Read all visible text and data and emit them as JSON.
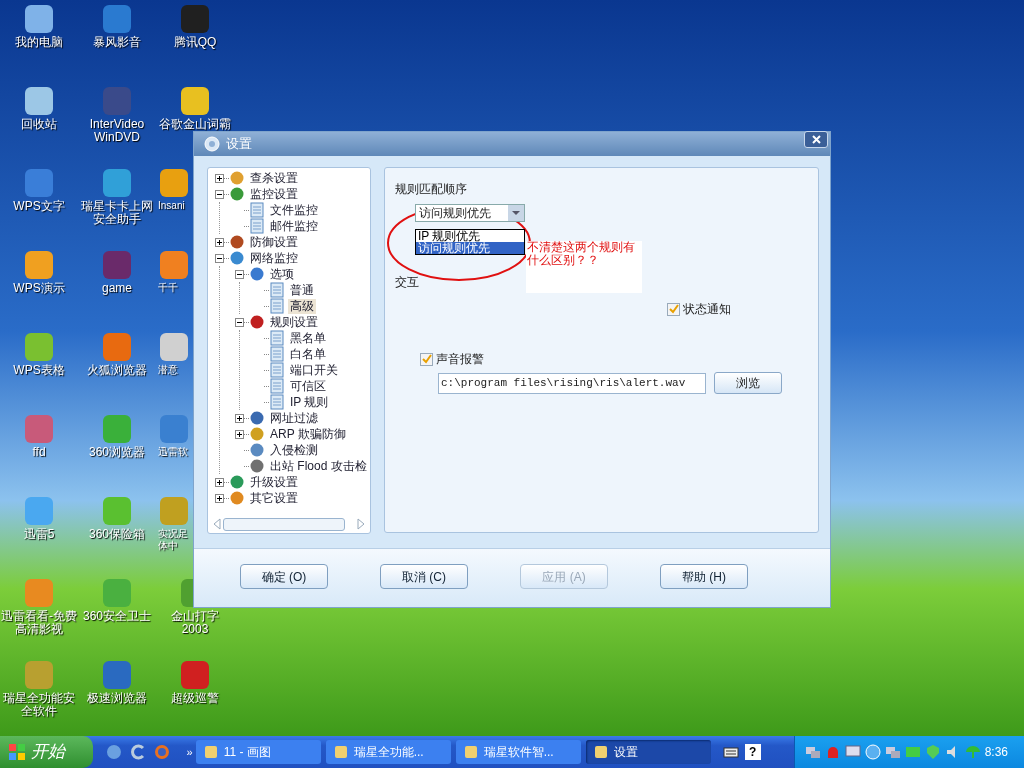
{
  "desktop_icons": [
    {
      "label": "我的电脑",
      "color": "#7fb2e8"
    },
    {
      "label": "回收站",
      "color": "#9cc7e6"
    },
    {
      "label": "WPS文字",
      "color": "#3a7ed8"
    },
    {
      "label": "WPS演示",
      "color": "#f0a020"
    },
    {
      "label": "WPS表格",
      "color": "#7ac030"
    },
    {
      "label": "ffd",
      "color": "#c85a7a"
    },
    {
      "label": "迅雷5",
      "color": "#4aa8f0"
    },
    {
      "label": "迅雷看看-免费高清影视",
      "color": "#e88a20"
    },
    {
      "label": "瑞星全功能安全软件",
      "color": "#b8a030"
    },
    {
      "label": "暴风影音",
      "color": "#2a7ad0"
    },
    {
      "label": "InterVideo WinDVD",
      "color": "#3a4a8a"
    },
    {
      "label": "瑞星卡卡上网安全助手",
      "color": "#30a0d8"
    },
    {
      "label": "game",
      "color": "#6a2a6a"
    },
    {
      "label": "火狐浏览器",
      "color": "#e86a10"
    },
    {
      "label": "360浏览器",
      "color": "#3ab03a"
    },
    {
      "label": "360保险箱",
      "color": "#5ac030"
    },
    {
      "label": "360安全卫士",
      "color": "#4ab040"
    },
    {
      "label": "极速浏览器",
      "color": "#2a6ac0"
    },
    {
      "label": "腾讯QQ",
      "color": "#202020"
    },
    {
      "label": "谷歌金山词霸",
      "color": "#e8c020"
    },
    {
      "label": "Insani",
      "color": "#e8a010"
    },
    {
      "label": "千千",
      "color": "#f08020"
    },
    {
      "label": "潜意",
      "color": "#d0d0d0"
    },
    {
      "label": "迅雷软",
      "color": "#3a80d0"
    },
    {
      "label": "实况足体中",
      "color": "#c0a020"
    },
    {
      "label": "金山打字 2003",
      "color": "#50a030"
    },
    {
      "label": "超级巡警",
      "color": "#d02020"
    }
  ],
  "dialog": {
    "title": "设置",
    "tree": [
      {
        "label": "查杀设置",
        "kind": "group",
        "color": "#e0a030",
        "expanded": false,
        "selected": false
      },
      {
        "label": "监控设置",
        "kind": "group",
        "color": "#3a9a3a",
        "expanded": true,
        "selected": false,
        "children": [
          {
            "label": "文件监控",
            "kind": "page",
            "selected": false
          },
          {
            "label": "邮件监控",
            "kind": "page",
            "selected": false
          }
        ]
      },
      {
        "label": "防御设置",
        "kind": "group",
        "color": "#b04a20",
        "expanded": false,
        "selected": false
      },
      {
        "label": "网络监控",
        "kind": "group",
        "color": "#3a8ad0",
        "expanded": true,
        "selected": false,
        "children": [
          {
            "label": "选项",
            "kind": "group",
            "color": "#3a7ad0",
            "expanded": true,
            "selected": false,
            "children": [
              {
                "label": "普通",
                "kind": "page",
                "selected": false
              },
              {
                "label": "高级",
                "kind": "page",
                "selected": true
              }
            ]
          },
          {
            "label": "规则设置",
            "kind": "group",
            "color": "#c02020",
            "expanded": true,
            "selected": false,
            "children": [
              {
                "label": "黑名单",
                "kind": "page",
                "selected": false
              },
              {
                "label": "白名单",
                "kind": "page",
                "selected": false
              },
              {
                "label": "端口开关",
                "kind": "page",
                "selected": false
              },
              {
                "label": "可信区",
                "kind": "page",
                "selected": false
              },
              {
                "label": "IP 规则",
                "kind": "page",
                "selected": false
              }
            ]
          },
          {
            "label": "网址过滤",
            "kind": "group",
            "color": "#3a6ab0",
            "expanded": false,
            "selected": false
          },
          {
            "label": "ARP 欺骗防御",
            "kind": "group",
            "color": "#d0a020",
            "expanded": false,
            "selected": false
          },
          {
            "label": "入侵检测",
            "kind": "group",
            "color": "#5a8ac0",
            "selected": false
          },
          {
            "label": "出站 Flood 攻击检",
            "kind": "group",
            "color": "#707070",
            "selected": false
          }
        ]
      },
      {
        "label": "升级设置",
        "kind": "group",
        "color": "#2a9a5a",
        "expanded": false,
        "selected": false
      },
      {
        "label": "其它设置",
        "kind": "group",
        "color": "#e08a20",
        "expanded": false,
        "selected": false
      }
    ],
    "match_order_label": "规则匹配顺序",
    "combo": {
      "value": "访问规则优先",
      "options": [
        {
          "label": "IP 规则优先",
          "selected": false
        },
        {
          "label": "访问规则优先",
          "selected": true
        }
      ]
    },
    "annotation": "不清楚这两个规则有什么区别？？",
    "interaction_label": "交互",
    "status_notify": {
      "label": "状态通知",
      "checked": true
    },
    "sound_alarm": {
      "label": "声音报警",
      "checked": true
    },
    "sound_file": {
      "value": "c:\\program files\\rising\\ris\\alert.wav"
    },
    "browse": "浏览",
    "buttons": [
      {
        "label": "确定 (O)",
        "disabled": false
      },
      {
        "label": "取消 (C)",
        "disabled": false
      },
      {
        "label": "应用 (A)",
        "disabled": true
      },
      {
        "label": "帮助 (H)",
        "disabled": false
      }
    ]
  },
  "taskbar": {
    "start": "开始",
    "more": "»",
    "tasks": [
      {
        "label": "11 - 画图",
        "selected": false
      },
      {
        "label": "瑞星全功能...",
        "selected": false
      },
      {
        "label": "瑞星软件智...",
        "selected": false
      },
      {
        "label": "设置",
        "selected": true
      }
    ],
    "help": "?",
    "time": "8:36"
  }
}
